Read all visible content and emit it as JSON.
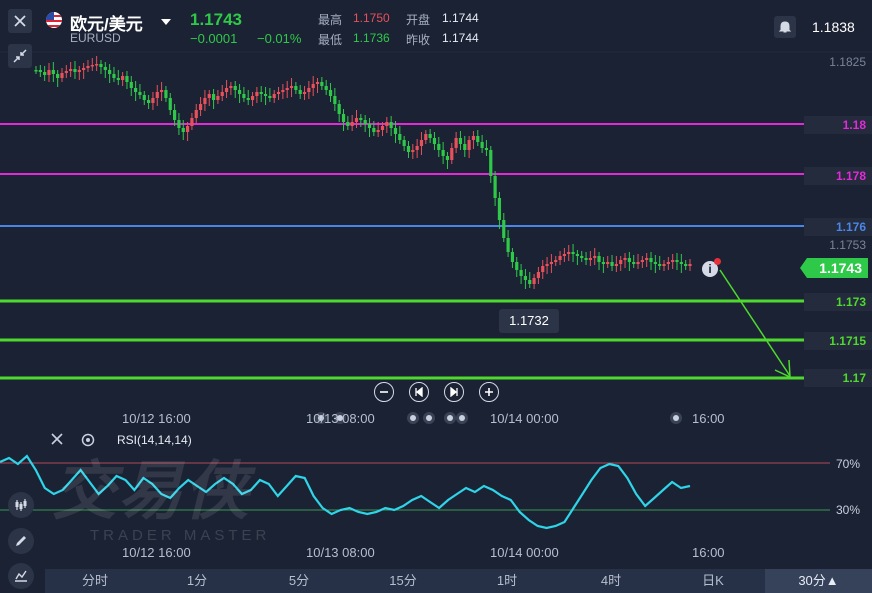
{
  "header": {
    "symbol_name": "欧元/美元",
    "symbol_code": "EURUSD",
    "last_price": "1.1743",
    "change": "−0.0001",
    "change_pct": "−0.01%",
    "high_label": "最高",
    "high_value": "1.1750",
    "open_label": "开盘",
    "open_value": "1.1744",
    "low_label": "最低",
    "low_value": "1.1736",
    "prev_close_label": "昨收",
    "prev_close_value": "1.1744",
    "alert_price": "1.1838"
  },
  "price_axis": {
    "plain_labels": [
      "1.1825",
      "1.1753"
    ],
    "level_lines": [
      {
        "label": "1.18",
        "color": "#e22ad8"
      },
      {
        "label": "1.178",
        "color": "#e22ad8"
      },
      {
        "label": "1.176",
        "color": "#4a86e8"
      },
      {
        "label": "1.173",
        "color": "#4fd92f"
      },
      {
        "label": "1.1715",
        "color": "#4fd92f"
      },
      {
        "label": "1.17",
        "color": "#4fd92f"
      }
    ],
    "current_price_tag": "1.1743",
    "crosshair_tooltip": "1.1732"
  },
  "time_axis": {
    "main_labels": [
      "10/12 16:00",
      "10/13 08:00",
      "10/14 00:00",
      "16:00"
    ],
    "rsi_labels": [
      "10/12 16:00",
      "10/13 08:00",
      "10/14 00:00",
      "16:00"
    ]
  },
  "rsi": {
    "label": "RSI(14,14,14)",
    "level_high": "70%",
    "level_low": "30%",
    "line_color": "#2fd4e8"
  },
  "watermark": {
    "text": "交易侠",
    "subtext": "TRADER MASTER"
  },
  "periods": [
    {
      "label": "分时",
      "active": false
    },
    {
      "label": "1分",
      "active": false
    },
    {
      "label": "5分",
      "active": false
    },
    {
      "label": "15分",
      "active": false
    },
    {
      "label": "1时",
      "active": false
    },
    {
      "label": "4时",
      "active": false
    },
    {
      "label": "日K",
      "active": false
    },
    {
      "label": "30分▲",
      "active": true
    }
  ],
  "colors": {
    "up": "#e8505b",
    "down": "#2fc94a",
    "background": "#1b2233"
  }
}
